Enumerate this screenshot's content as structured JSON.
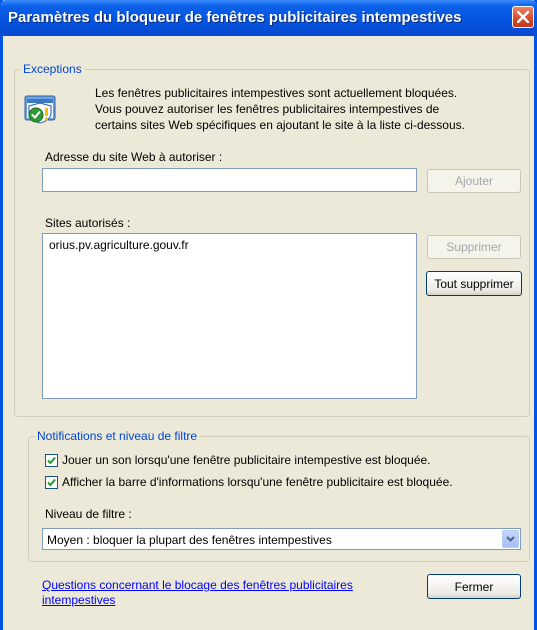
{
  "window": {
    "title": "Paramètres du bloqueur de fenêtres publicitaires intempestives"
  },
  "exceptions": {
    "legend": "Exceptions",
    "info_line1": "Les fenêtres publicitaires intempestives sont actuellement bloquées.",
    "info_line2": "Vous pouvez autoriser les fenêtres publicitaires intempestives de",
    "info_line3": "certains sites Web spécifiques en ajoutant le site à la liste ci-dessous.",
    "address_label": "Adresse du site Web à autoriser :",
    "address_value": "",
    "add_button": "Ajouter",
    "allowed_label": "Sites autorisés :",
    "allowed_sites": [
      "orius.pv.agriculture.gouv.fr"
    ],
    "remove_button": "Supprimer",
    "remove_all_button": "Tout supprimer"
  },
  "notifications": {
    "legend": "Notifications et niveau de filtre",
    "play_sound_label": "Jouer un son lorsqu'une fenêtre publicitaire intempestive est bloquée.",
    "play_sound_checked": true,
    "show_infobar_label": "Afficher la barre d'informations lorsqu'une fenêtre publicitaire est bloquée.",
    "show_infobar_checked": true,
    "filter_label": "Niveau de filtre :",
    "filter_value": "Moyen : bloquer la plupart des fenêtres intempestives"
  },
  "footer": {
    "help_link_line1": "Questions concernant le blocage des fenêtres publicitaires",
    "help_link_line2": "intempestives",
    "close_button": "Fermer"
  },
  "icons": {
    "close": "close-icon",
    "info": "security-shield-icon",
    "check": "check-icon",
    "dropdown": "chevron-down-icon"
  },
  "colors": {
    "title_bar": "#0554e0",
    "window_bg": "#ece9d8",
    "group_legend": "#0046d5",
    "link": "#0000ff"
  }
}
